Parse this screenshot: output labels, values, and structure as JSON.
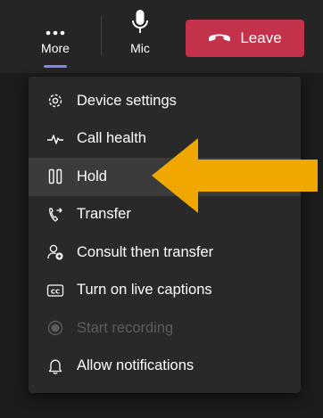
{
  "toolbar": {
    "more_label": "More",
    "mic_label": "Mic",
    "leave_label": "Leave",
    "more_icon": "more-dots-icon",
    "mic_icon": "microphone-icon",
    "leave_icon": "phone-hangup-icon"
  },
  "menu": {
    "items": [
      {
        "label": "Device settings",
        "icon": "gear-icon"
      },
      {
        "label": "Call health",
        "icon": "pulse-icon"
      },
      {
        "label": "Hold",
        "icon": "pause-icon"
      },
      {
        "label": "Transfer",
        "icon": "transfer-phone-icon"
      },
      {
        "label": "Consult then transfer",
        "icon": "person-add-icon"
      },
      {
        "label": "Turn on live captions",
        "icon": "cc-icon"
      },
      {
        "label": "Start recording",
        "icon": "record-icon"
      },
      {
        "label": "Allow notifications",
        "icon": "bell-icon"
      }
    ]
  },
  "colors": {
    "leave_button": "#c4314b",
    "accent_underline": "#7f85f5",
    "annotation_arrow": "#f0a800",
    "menu_background": "#292929",
    "highlight_background": "#3b3b3b"
  }
}
